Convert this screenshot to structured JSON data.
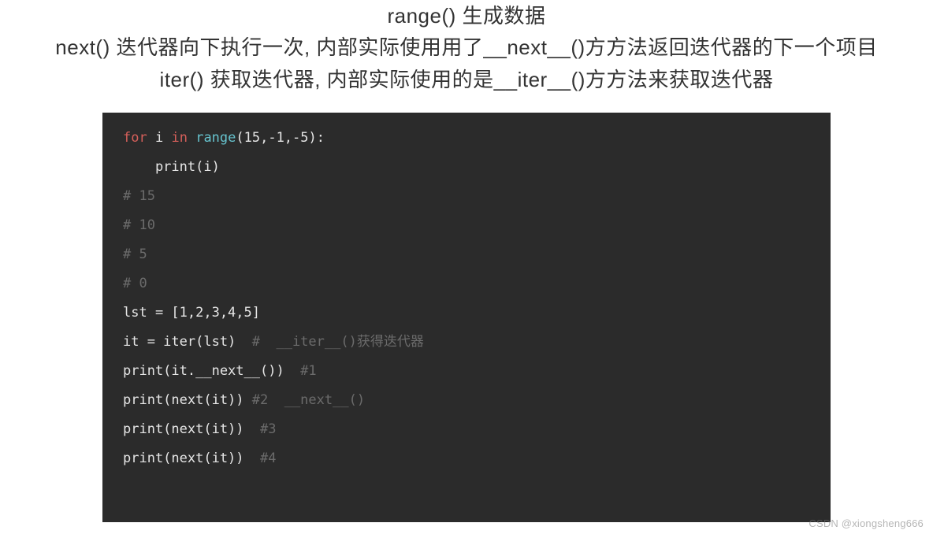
{
  "header": {
    "line1": "range() 生成数据",
    "line2": "next() 迭代器向下执行一次, 内部实际使用用了__next__()方方法返回迭代器的下一个项目",
    "line3": "iter() 获取迭代器, 内部实际使用的是__iter__()方方法来获取迭代器"
  },
  "code": {
    "l1_for": "for",
    "l1_sp1": " ",
    "l1_var": "i",
    "l1_sp2": " ",
    "l1_in": "in",
    "l1_sp3": " ",
    "l1_fn": "range",
    "l1_args": "(15,-1,-5):",
    "l2": "    print(i)",
    "l3": "# 15",
    "l4": "# 10",
    "l5": "# 5",
    "l6": "# 0",
    "l7": "lst = [1,2,3,4,5]",
    "l8_a": "it = iter(lst)  ",
    "l8_b": "#  __iter__()获得迭代器",
    "l9_a": "print(it.__next__())  ",
    "l9_b": "#1",
    "l10_a": "print(next(it)) ",
    "l10_b": "#2  __next__()",
    "l11_a": "print(next(it))  ",
    "l11_b": "#3",
    "l12_a": "print(next(it))  ",
    "l12_b": "#4"
  },
  "watermark": "CSDN @xiongsheng666"
}
